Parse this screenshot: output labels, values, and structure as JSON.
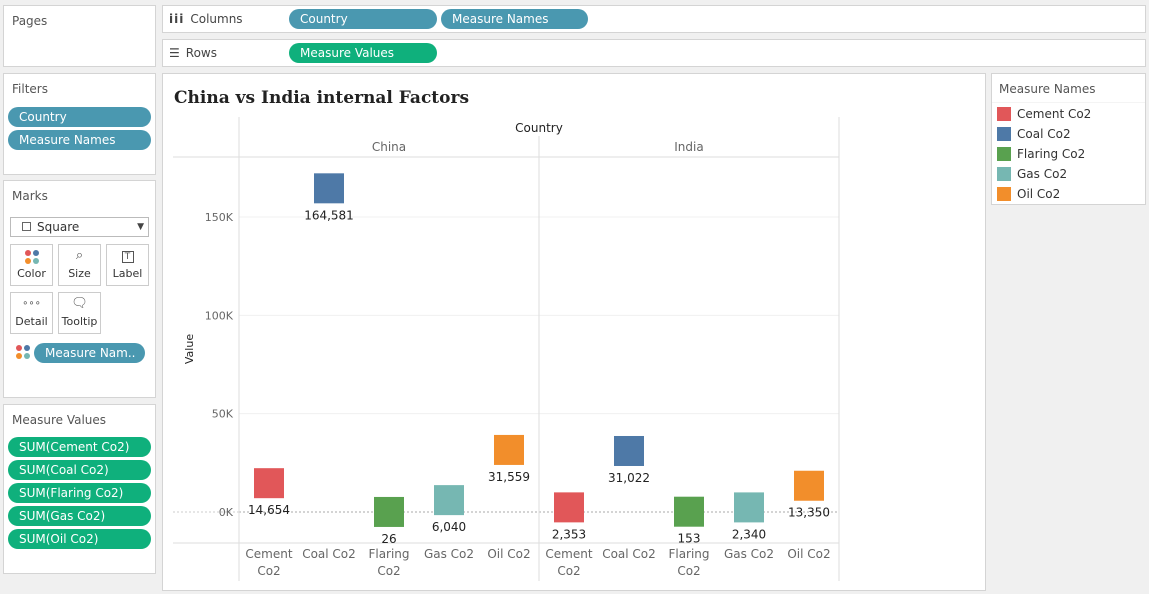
{
  "pages": {
    "title": "Pages"
  },
  "columns": {
    "label": "Columns",
    "pills": [
      "Country",
      "Measure Names"
    ]
  },
  "rows": {
    "label": "Rows",
    "pills": [
      "Measure Values"
    ]
  },
  "filters": {
    "title": "Filters",
    "pills": [
      "Country",
      "Measure Names"
    ]
  },
  "marks": {
    "title": "Marks",
    "type": "Square",
    "buttons": {
      "color": "Color",
      "size": "Size",
      "label": "Label",
      "detail": "Detail",
      "tooltip": "Tooltip"
    },
    "color_pill": "Measure Nam.."
  },
  "measure_values": {
    "title": "Measure Values",
    "pills": [
      "SUM(Cement Co2)",
      "SUM(Coal Co2)",
      "SUM(Flaring Co2)",
      "SUM(Gas Co2)",
      "SUM(Oil Co2)"
    ]
  },
  "legend": {
    "title": "Measure Names",
    "items": [
      {
        "name": "Cement Co2",
        "color": "#e15759"
      },
      {
        "name": "Coal Co2",
        "color": "#4e79a7"
      },
      {
        "name": "Flaring Co2",
        "color": "#59a14f"
      },
      {
        "name": "Gas Co2",
        "color": "#76b7b2"
      },
      {
        "name": "Oil Co2",
        "color": "#f28e2b"
      }
    ]
  },
  "chart_data": {
    "type": "scatter",
    "title": "China vs India internal Factors",
    "column_header": "Country",
    "ylabel": "Value",
    "ylim": [
      -15000,
      180000
    ],
    "yticks": [
      0,
      50000,
      100000,
      150000
    ],
    "ytick_labels": [
      "0K",
      "50K",
      "100K",
      "150K"
    ],
    "panels": [
      {
        "country": "China",
        "values": [
          14654,
          164581,
          26,
          6040,
          31559
        ],
        "labels": [
          "14,654",
          "164,581",
          "26",
          "6,040",
          "31,559"
        ]
      },
      {
        "country": "India",
        "values": [
          2353,
          31022,
          153,
          2340,
          13350
        ],
        "labels": [
          "2,353",
          "31,022",
          "153",
          "2,340",
          "13,350"
        ]
      }
    ],
    "categories": [
      [
        "Cement",
        "Co2"
      ],
      [
        "Coal Co2"
      ],
      [
        "Flaring",
        "Co2"
      ],
      [
        "Gas Co2"
      ],
      [
        "Oil Co2"
      ]
    ],
    "colors": [
      "#e15759",
      "#4e79a7",
      "#59a14f",
      "#76b7b2",
      "#f28e2b"
    ]
  }
}
